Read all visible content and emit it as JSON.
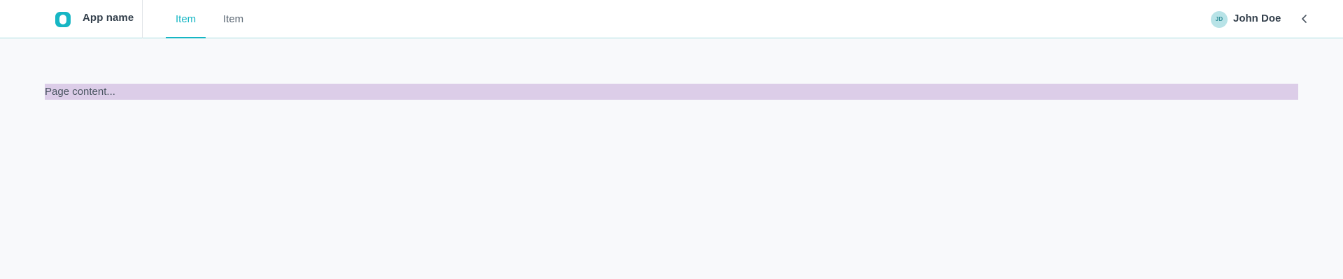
{
  "header": {
    "app_name": "App name",
    "logo_icon": "app-logo-icon",
    "nav": [
      {
        "label": "Item",
        "active": true
      },
      {
        "label": "Item",
        "active": false
      }
    ],
    "user": {
      "initials": "JD",
      "name": "John Doe",
      "collapse_icon": "chevron-left-icon"
    }
  },
  "main": {
    "content_text": "Page content..."
  },
  "colors": {
    "accent": "#16b6c4",
    "content_highlight": "#dccde8",
    "background": "#f8f9fb"
  }
}
